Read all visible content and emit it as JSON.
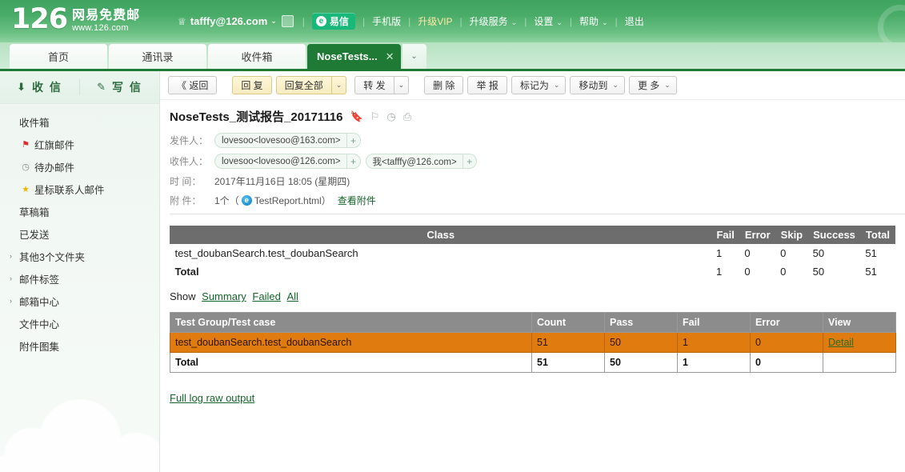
{
  "header": {
    "logo_number": "126",
    "logo_cn": "网易免费邮",
    "logo_url": "www.126.com",
    "account": "tafffy@126.com",
    "crown_icon": "crown-icon",
    "account_caret": "⌄",
    "mail_icon": "mail-icon",
    "yixin_label": "易信",
    "yixin_mark": "e",
    "nav": [
      {
        "label": "手机版",
        "kind": "plain"
      },
      {
        "label": "升级VIP",
        "kind": "vip"
      },
      {
        "label": "升级服务",
        "kind": "menu"
      },
      {
        "label": "设置",
        "kind": "menu"
      },
      {
        "label": "帮助",
        "kind": "menu"
      },
      {
        "label": "退出",
        "kind": "plain"
      }
    ],
    "separator": "|",
    "circle_icon": "circle-watermark-icon"
  },
  "tabs": {
    "items": [
      {
        "label": "首页",
        "active": false
      },
      {
        "label": "通讯录",
        "active": false
      },
      {
        "label": "收件箱",
        "active": false
      },
      {
        "label": "NoseTests...",
        "active": true
      }
    ],
    "close_glyph": "✕",
    "dropdown_glyph": "⌄"
  },
  "sidebar": {
    "actions": [
      {
        "label": "收 信",
        "icon": "receive-mail-icon",
        "glyph": "⬇"
      },
      {
        "label": "写 信",
        "icon": "compose-mail-icon",
        "glyph": "✎"
      }
    ],
    "items": [
      {
        "label": "收件箱",
        "icon": "",
        "glyph": "",
        "arrow": ""
      },
      {
        "label": "红旗邮件",
        "icon": "red-flag-icon",
        "glyph": "⚑",
        "arrow": "",
        "color": "red"
      },
      {
        "label": "待办邮件",
        "icon": "clock-icon",
        "glyph": "◷",
        "arrow": "",
        "color": "gray"
      },
      {
        "label": "星标联系人邮件",
        "icon": "star-icon",
        "glyph": "★",
        "arrow": "",
        "color": "star"
      },
      {
        "label": "草稿箱",
        "icon": "",
        "glyph": "",
        "arrow": ""
      },
      {
        "label": "已发送",
        "icon": "",
        "glyph": "",
        "arrow": ""
      },
      {
        "label": "其他3个文件夹",
        "icon": "chevron-right-icon",
        "glyph": "",
        "arrow": "›"
      },
      {
        "label": "邮件标签",
        "icon": "chevron-right-icon",
        "glyph": "",
        "arrow": "›"
      },
      {
        "label": "邮箱中心",
        "icon": "chevron-right-icon",
        "glyph": "",
        "arrow": "›"
      },
      {
        "label": "文件中心",
        "icon": "",
        "glyph": "",
        "arrow": ""
      },
      {
        "label": "附件图集",
        "icon": "",
        "glyph": "",
        "arrow": ""
      }
    ]
  },
  "toolbar": {
    "back_label": "《 返回",
    "reply_label": "回 复",
    "reply_all_label": "回复全部",
    "forward_label": "转 发",
    "delete_label": "删 除",
    "report_label": "举 报",
    "mark_as_label": "标记为",
    "move_to_label": "移动到",
    "more_label": "更 多",
    "caret": "⌄"
  },
  "mail": {
    "subject": "NoseTests_测试报告_20171116",
    "subject_icons": [
      "bookmark-icon",
      "flag-icon",
      "clock-icon",
      "print-icon"
    ],
    "subject_glyphs": [
      "🔖",
      "⚐",
      "◷",
      "⎙"
    ],
    "from_label": "发件人：",
    "from_chips": [
      {
        "text": "lovesoo<lovesoo@163.com>",
        "plus": "+"
      }
    ],
    "to_label": "收件人：",
    "to_chips": [
      {
        "text": "lovesoo<lovesoo@126.com>",
        "plus": "+"
      },
      {
        "text": "我<tafffy@126.com>",
        "plus": "+"
      }
    ],
    "time_label": "时  间：",
    "time_value": "2017年11月16日 18:05 (星期四)",
    "attach_label": "附  件：",
    "attach_count": "1个（",
    "attach_name": "TestReport.html",
    "attach_close": "）",
    "attach_view": "查看附件",
    "attach_icon": "ie-icon"
  },
  "report": {
    "summary_table": {
      "headers": [
        "Class",
        "Fail",
        "Error",
        "Skip",
        "Success",
        "Total"
      ],
      "rows": [
        {
          "class": "test_doubanSearch.test_doubanSearch",
          "fail": "1",
          "error": "0",
          "skip": "0",
          "success": "50",
          "total": "51"
        }
      ],
      "total_row": {
        "class": "Total",
        "fail": "1",
        "error": "0",
        "skip": "0",
        "success": "50",
        "total": "51"
      }
    },
    "show_label": "Show",
    "show_links": [
      "Summary",
      "Failed",
      "All"
    ],
    "detail_table": {
      "headers": [
        "Test Group/Test case",
        "Count",
        "Pass",
        "Fail",
        "Error",
        "View"
      ],
      "rows": [
        {
          "name": "test_doubanSearch.test_doubanSearch",
          "count": "51",
          "pass": "50",
          "fail": "1",
          "error": "0",
          "view": "Detail",
          "highlight": true
        }
      ],
      "total_row": {
        "name": "Total",
        "count": "51",
        "pass": "50",
        "fail": "1",
        "error": "0",
        "view": ""
      }
    },
    "raw_output_link": "Full log raw output"
  },
  "colors": {
    "header_green": "#49ab68",
    "active_tab_green": "#1e7a35",
    "table_header_gray": "#6d6d6d",
    "detail_header_gray": "#8c8c8c",
    "fail_row_orange": "#e07b10",
    "link_green": "#15642a"
  }
}
